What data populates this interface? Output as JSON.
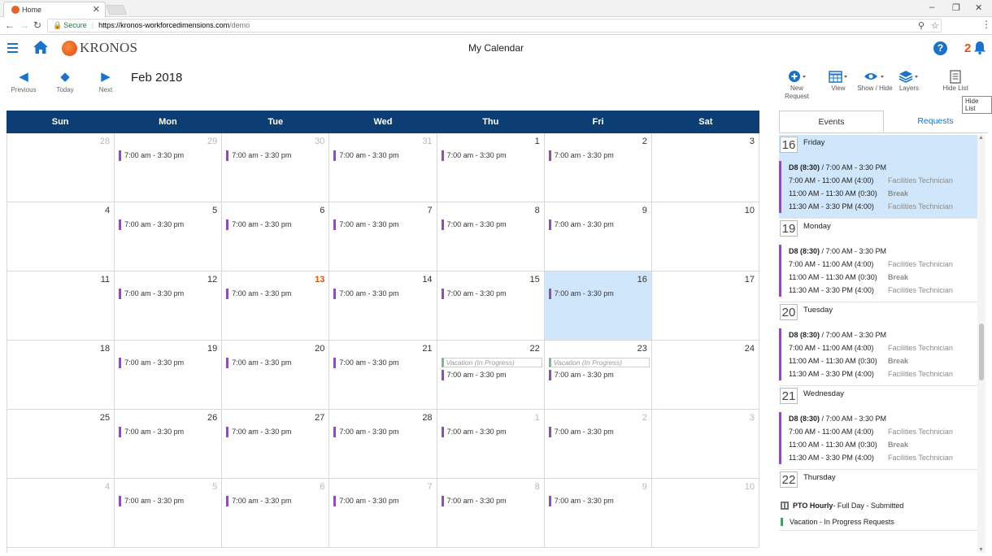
{
  "browser": {
    "tab_title": "Home",
    "secure_label": "Secure",
    "url_domain": "https://kronos-workforcedimensions.com",
    "url_path": "/demo"
  },
  "app": {
    "logo_text": "KRONOS",
    "page_title": "My Calendar",
    "notification_count": "2"
  },
  "toolbar": {
    "previous": "Previous",
    "today": "Today",
    "next": "Next",
    "month": "Feb 2018",
    "new_request": "New Request",
    "view": "View",
    "show_hide": "Show / Hide",
    "layers": "Layers",
    "hide_list": "Hide List",
    "tooltip": "Hide List"
  },
  "calendar": {
    "weekdays": [
      "Sun",
      "Mon",
      "Tue",
      "Wed",
      "Thu",
      "Fri",
      "Sat"
    ],
    "shift_label": "7:00 am - 3:30 pm",
    "vacation_label": "Vacation (In Progress)",
    "weeks": [
      [
        {
          "d": "28",
          "o": true
        },
        {
          "d": "29",
          "o": true,
          "s": true
        },
        {
          "d": "30",
          "o": true,
          "s": true
        },
        {
          "d": "31",
          "o": true,
          "s": true
        },
        {
          "d": "1",
          "s": true
        },
        {
          "d": "2",
          "s": true
        },
        {
          "d": "3"
        }
      ],
      [
        {
          "d": "4"
        },
        {
          "d": "5",
          "s": true
        },
        {
          "d": "6",
          "s": true
        },
        {
          "d": "7",
          "s": true
        },
        {
          "d": "8",
          "s": true
        },
        {
          "d": "9",
          "s": true
        },
        {
          "d": "10"
        }
      ],
      [
        {
          "d": "11"
        },
        {
          "d": "12",
          "s": true
        },
        {
          "d": "13",
          "s": true,
          "t": true
        },
        {
          "d": "14",
          "s": true
        },
        {
          "d": "15",
          "s": true
        },
        {
          "d": "16",
          "s": true,
          "sel": true
        },
        {
          "d": "17"
        }
      ],
      [
        {
          "d": "18"
        },
        {
          "d": "19",
          "s": true
        },
        {
          "d": "20",
          "s": true
        },
        {
          "d": "21",
          "s": true
        },
        {
          "d": "22",
          "s": true,
          "v": true
        },
        {
          "d": "23",
          "s": true,
          "v": true
        },
        {
          "d": "24"
        }
      ],
      [
        {
          "d": "25"
        },
        {
          "d": "26",
          "s": true
        },
        {
          "d": "27",
          "s": true
        },
        {
          "d": "28",
          "s": true
        },
        {
          "d": "1",
          "o": true,
          "s": true
        },
        {
          "d": "2",
          "o": true,
          "s": true
        },
        {
          "d": "3",
          "o": true
        }
      ],
      [
        {
          "d": "4",
          "o": true
        },
        {
          "d": "5",
          "o": true,
          "s": true
        },
        {
          "d": "6",
          "o": true,
          "s": true
        },
        {
          "d": "7",
          "o": true,
          "s": true
        },
        {
          "d": "8",
          "o": true,
          "s": true
        },
        {
          "d": "9",
          "o": true,
          "s": true
        },
        {
          "d": "10",
          "o": true
        }
      ]
    ]
  },
  "panel": {
    "tab_events": "Events",
    "tab_requests": "Requests",
    "days": [
      {
        "num": "16",
        "name": "Friday",
        "selected": true,
        "header_bold": "D8 (8:30)",
        "header_rest": " / 7:00 AM - 3:30 PM",
        "lines": [
          {
            "time": "7:00 AM - 11:00 AM (4:00)",
            "role": "Facilities Technician",
            "break": false
          },
          {
            "time": "11:00 AM - 11:30 AM (0:30)",
            "role": "Break",
            "break": true
          },
          {
            "time": "11:30 AM - 3:30 PM (4:00)",
            "role": "Facilities Technician",
            "break": false
          }
        ]
      },
      {
        "num": "19",
        "name": "Monday",
        "header_bold": "D8 (8:30)",
        "header_rest": " / 7:00 AM - 3:30 PM",
        "lines": [
          {
            "time": "7:00 AM - 11:00 AM (4:00)",
            "role": "Facilities Technician",
            "break": false
          },
          {
            "time": "11:00 AM - 11:30 AM (0:30)",
            "role": "Break",
            "break": true
          },
          {
            "time": "11:30 AM - 3:30 PM (4:00)",
            "role": "Facilities Technician",
            "break": false
          }
        ]
      },
      {
        "num": "20",
        "name": "Tuesday",
        "header_bold": "D8 (8:30)",
        "header_rest": " / 7:00 AM - 3:30 PM",
        "lines": [
          {
            "time": "7:00 AM - 11:00 AM (4:00)",
            "role": "Facilities Technician",
            "break": false
          },
          {
            "time": "11:00 AM - 11:30 AM (0:30)",
            "role": "Break",
            "break": true
          },
          {
            "time": "11:30 AM - 3:30 PM (4:00)",
            "role": "Facilities Technician",
            "break": false
          }
        ]
      },
      {
        "num": "21",
        "name": "Wednesday",
        "header_bold": "D8 (8:30)",
        "header_rest": " / 7:00 AM - 3:30 PM",
        "lines": [
          {
            "time": "7:00 AM - 11:00 AM (4:00)",
            "role": "Facilities Technician",
            "break": false
          },
          {
            "time": "11:00 AM - 11:30 AM (0:30)",
            "role": "Break",
            "break": true
          },
          {
            "time": "11:30 AM - 3:30 PM (4:00)",
            "role": "Facilities Technician",
            "break": false
          }
        ]
      }
    ],
    "thursday": {
      "num": "22",
      "name": "Thursday",
      "pto_bold": "PTO Hourly",
      "pto_rest": " - Full Day - Submitted",
      "vacation": "Vacation - In Progress Requests"
    }
  },
  "colors": {
    "header_navy": "#0d3e73",
    "accent_blue": "#1a73c8",
    "shift_purple": "#8d4fb0",
    "today_orange": "#d45a16",
    "selected_bg": "#cfe6fb"
  }
}
